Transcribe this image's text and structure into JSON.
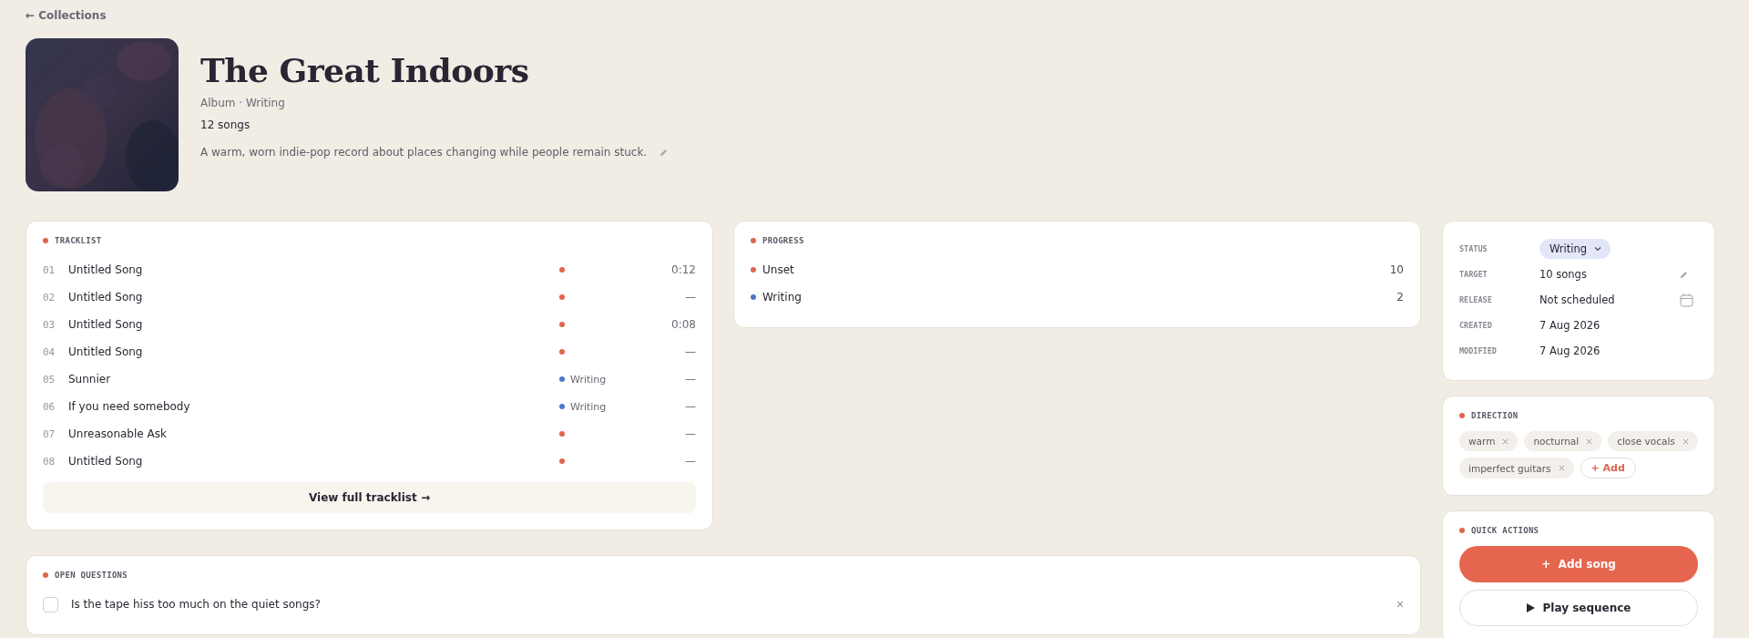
{
  "back_link": "← Collections",
  "album": {
    "title": "The Great Indoors",
    "meta": "Album · Writing",
    "song_count": "12 songs",
    "description": "A warm, worn indie-pop record about places changing while people remain stuck."
  },
  "tracklist": {
    "title": "TRACKLIST",
    "color": "#e0654f",
    "tracks": [
      {
        "number": "01",
        "name": "Untitled Song",
        "color": "#e0654f",
        "duration": "0:12"
      },
      {
        "number": "02",
        "name": "Untitled Song",
        "color": "#e0654f",
        "duration": "—"
      },
      {
        "number": "03",
        "name": "Untitled Song",
        "color": "#e0654f",
        "duration": "0:08"
      },
      {
        "number": "04",
        "name": "Untitled Song",
        "color": "#e0654f",
        "duration": "—"
      },
      {
        "number": "05",
        "name": "Sunnier",
        "color": "#4e76c9",
        "status": "Writing",
        "duration": "—"
      },
      {
        "number": "06",
        "name": "If you need somebody",
        "color": "#4e76c9",
        "status": "Writing",
        "duration": "—"
      },
      {
        "number": "07",
        "name": "Unreasonable Ask",
        "color": "#e0654f",
        "duration": "—"
      },
      {
        "number": "08",
        "name": "Untitled Song",
        "color": "#e0654f",
        "duration": "—"
      }
    ],
    "view_all": "View full tracklist →"
  },
  "progress": {
    "title": "PROGRESS",
    "color": "#e0654f",
    "items": [
      {
        "label": "Unset",
        "color": "#e0654f",
        "count": "10"
      },
      {
        "label": "Writing",
        "color": "#4e76c9",
        "count": "2"
      }
    ]
  },
  "open_questions": {
    "title": "OPEN QUESTIONS",
    "color": "#e0654f",
    "items": [
      {
        "text": "Is the tape hiss too much on the quiet songs?",
        "checked": false
      }
    ]
  },
  "details": [
    {
      "kind": "status",
      "label": "STATUS",
      "value": "Writing"
    },
    {
      "kind": "edit",
      "label": "TARGET",
      "value": "10 songs"
    },
    {
      "kind": "date",
      "label": "RELEASE",
      "value": "Not scheduled"
    },
    {
      "kind": "plain",
      "label": "CREATED",
      "value": "7 Aug 2026"
    },
    {
      "kind": "plain",
      "label": "MODIFIED",
      "value": "7 Aug 2026"
    }
  ],
  "direction": {
    "title": "DIRECTION",
    "color": "#e0654f",
    "tags": [
      "warm",
      "nocturnal",
      "close vocals",
      "imperfect guitars"
    ],
    "add_label": "+ Add"
  },
  "quick_actions": {
    "title": "QUICK ACTIONS",
    "color": "#e0654f",
    "primary": "+  Add song",
    "secondary": "Play sequence"
  }
}
